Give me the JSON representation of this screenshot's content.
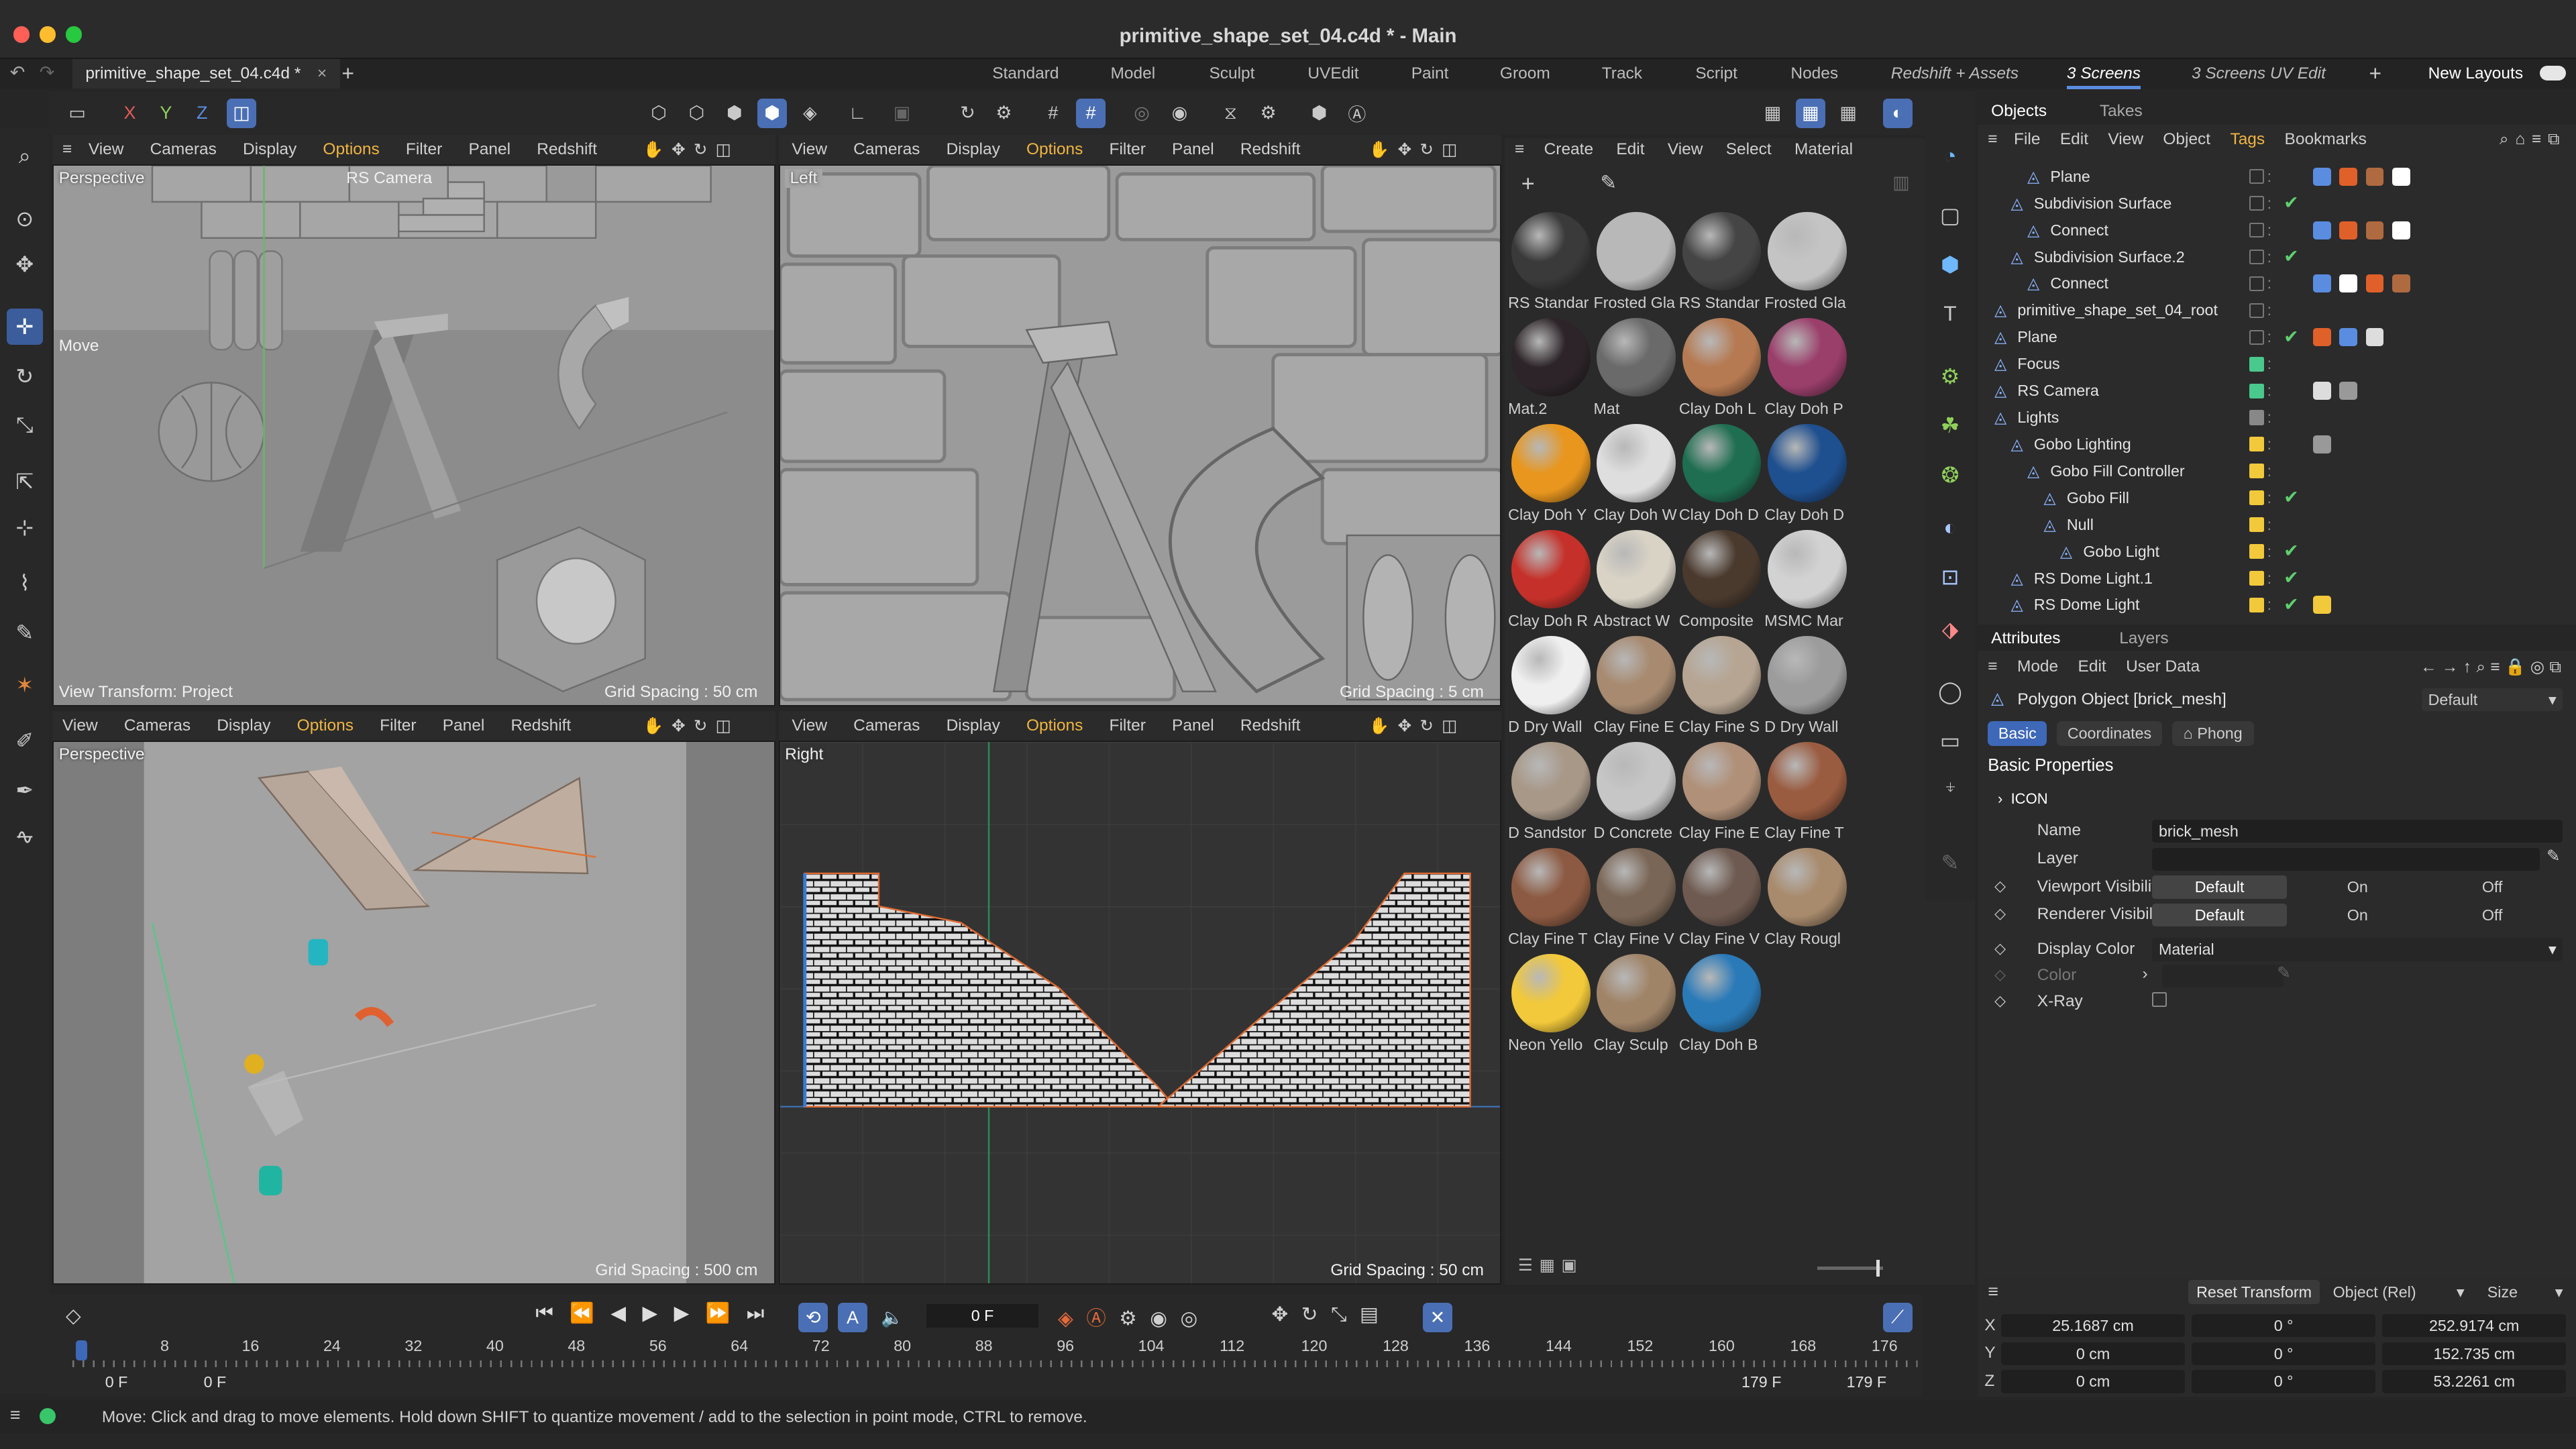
{
  "window": {
    "title": "primitive_shape_set_04.c4d * - Main",
    "file_tab": "primitive_shape_set_04.c4d *"
  },
  "layouts": [
    "Standard",
    "Model",
    "Sculpt",
    "UVEdit",
    "Paint",
    "Groom",
    "Track",
    "Script",
    "Nodes",
    "Redshift + Assets",
    "3 Screens",
    "3 Screens UV Edit"
  ],
  "active_layout": "3 Screens",
  "new_layouts_label": "New Layouts",
  "axis_toggles": [
    "X",
    "Y",
    "Z"
  ],
  "viewport_menu": [
    "View",
    "Cameras",
    "Display",
    "Options",
    "Filter",
    "Panel",
    "Redshift"
  ],
  "viewports": {
    "top_left": {
      "label": "Perspective",
      "camera": "RS Camera",
      "tool": "Move",
      "view_transform": "View Transform: Project",
      "grid": "Grid Spacing : 50 cm"
    },
    "top_right": {
      "label": "Left",
      "grid": "Grid Spacing : 5 cm"
    },
    "bottom_left": {
      "label": "Perspective",
      "grid": "Grid Spacing : 500 cm"
    },
    "bottom_right": {
      "label": "Right",
      "grid": "Grid Spacing : 50 cm"
    }
  },
  "material_manager": {
    "menu": [
      "Create",
      "Edit",
      "View",
      "Select",
      "Material"
    ],
    "materials": [
      {
        "name": "RS Standar",
        "color": "#3a3a3a"
      },
      {
        "name": "Frosted Gla",
        "color": "#b8b8b8"
      },
      {
        "name": "RS Standar",
        "color": "#454545"
      },
      {
        "name": "Frosted Gla",
        "color": "#c4c4c4"
      },
      {
        "name": "Mat.2",
        "color": "#2c2428"
      },
      {
        "name": "Mat",
        "color": "#6a6a6a"
      },
      {
        "name": "Clay Doh L",
        "color": "#b67a52"
      },
      {
        "name": "Clay Doh P",
        "color": "#9a3e6a"
      },
      {
        "name": "Clay Doh Y",
        "color": "#e8961e"
      },
      {
        "name": "Clay Doh W",
        "color": "#dedede"
      },
      {
        "name": "Clay Doh D",
        "color": "#1f6e52"
      },
      {
        "name": "Clay Doh D",
        "color": "#1e4f8e"
      },
      {
        "name": "Clay Doh R",
        "color": "#c5312a"
      },
      {
        "name": "Abstract W",
        "color": "#d9d3c6"
      },
      {
        "name": "Composite",
        "color": "#4a3a2e"
      },
      {
        "name": "MSMC Mar",
        "color": "#d2d2d2"
      },
      {
        "name": "D Dry Wall",
        "color": "#efefef"
      },
      {
        "name": "Clay Fine E",
        "color": "#a78a70"
      },
      {
        "name": "Clay Fine S",
        "color": "#b6a592"
      },
      {
        "name": "D Dry Wall",
        "color": "#9c9c9c"
      },
      {
        "name": "D Sandstor",
        "color": "#a89888"
      },
      {
        "name": "D Concrete",
        "color": "#c6c6c6"
      },
      {
        "name": "Clay Fine E",
        "color": "#b09078"
      },
      {
        "name": "Clay Fine T",
        "color": "#9a5c40"
      },
      {
        "name": "Clay Fine T",
        "color": "#8c5a42"
      },
      {
        "name": "Clay Fine V",
        "color": "#7a6656"
      },
      {
        "name": "Clay Fine V",
        "color": "#6e5a50"
      },
      {
        "name": "Clay Rougl",
        "color": "#a88a6c"
      },
      {
        "name": "Neon Yello",
        "color": "#f2c93a"
      },
      {
        "name": "Clay Sculp",
        "color": "#a08468"
      },
      {
        "name": "Clay Doh B",
        "color": "#2a7ab8"
      }
    ]
  },
  "object_manager": {
    "tabs": [
      "Objects",
      "Takes"
    ],
    "menu": [
      "File",
      "Edit",
      "View",
      "Object",
      "Tags",
      "Bookmarks"
    ],
    "rows": [
      {
        "name": "Plane",
        "indent": 3,
        "vis": "box",
        "check": false
      },
      {
        "name": "Subdivision Surface",
        "indent": 2,
        "vis": "box",
        "check": true
      },
      {
        "name": "Connect",
        "indent": 3,
        "vis": "box",
        "check": false
      },
      {
        "name": "Subdivision Surface.2",
        "indent": 2,
        "vis": "box",
        "check": true
      },
      {
        "name": "Connect",
        "indent": 3,
        "vis": "box",
        "check": false
      },
      {
        "name": "primitive_shape_set_04_root",
        "indent": 1,
        "vis": "box",
        "check": false
      },
      {
        "name": "Plane",
        "indent": 1,
        "vis": "box",
        "check": true
      },
      {
        "name": "Focus",
        "indent": 1,
        "vis": "#49c98c",
        "check": false
      },
      {
        "name": "RS Camera",
        "indent": 1,
        "vis": "#49c98c",
        "check": false
      },
      {
        "name": "Lights",
        "indent": 1,
        "vis": "#888888",
        "check": false
      },
      {
        "name": "Gobo Lighting",
        "indent": 2,
        "vis": "#f2c93a",
        "check": false
      },
      {
        "name": "Gobo Fill Controller",
        "indent": 3,
        "vis": "#f2c93a",
        "check": false
      },
      {
        "name": "Gobo Fill",
        "indent": 4,
        "vis": "#f2c93a",
        "check": true
      },
      {
        "name": "Null",
        "indent": 4,
        "vis": "#f2c93a",
        "check": false
      },
      {
        "name": "Gobo Light",
        "indent": 5,
        "vis": "#f2c93a",
        "check": true
      },
      {
        "name": "RS Dome Light.1",
        "indent": 2,
        "vis": "#f2c93a",
        "check": true
      },
      {
        "name": "RS Dome Light",
        "indent": 2,
        "vis": "#f2c93a",
        "check": true
      }
    ]
  },
  "attributes": {
    "tabs": [
      "Attributes",
      "Layers"
    ],
    "menu": [
      "Mode",
      "Edit",
      "User Data"
    ],
    "object_title": "Polygon Object [brick_mesh]",
    "preset": "Default",
    "subtabs": [
      "Basic",
      "Coordinates",
      "Phong"
    ],
    "section": "Basic Properties",
    "group": "ICON",
    "fields": {
      "name_label": "Name",
      "name_value": "brick_mesh",
      "layer_label": "Layer",
      "viewport_label": "Viewport Visibility",
      "renderer_label": "Renderer Visibility",
      "display_color_label": "Display Color",
      "display_color_value": "Material",
      "color_label": "Color",
      "xray_label": "X-Ray"
    },
    "vis_options": [
      "Default",
      "On",
      "Off"
    ]
  },
  "timeline": {
    "current_frame": "0 F",
    "ticks": [
      "0",
      "8",
      "16",
      "24",
      "32",
      "40",
      "48",
      "56",
      "64",
      "72",
      "80",
      "88",
      "96",
      "104",
      "112",
      "120",
      "128",
      "136",
      "144",
      "152",
      "160",
      "168",
      "176"
    ],
    "start": "0 F",
    "start2": "0 F",
    "end": "179 F",
    "end2": "179 F"
  },
  "coordinates": {
    "reset_label": "Reset Transform",
    "mode": "Object (Rel)",
    "size_label": "Size",
    "rows": [
      {
        "axis": "X",
        "pos": "25.1687 cm",
        "rot": "0 °",
        "size": "252.9174 cm"
      },
      {
        "axis": "Y",
        "pos": "0 cm",
        "rot": "0 °",
        "size": "152.735 cm"
      },
      {
        "axis": "Z",
        "pos": "0 cm",
        "rot": "0 °",
        "size": "53.2261 cm"
      }
    ]
  },
  "status": "Move: Click and drag to move elements. Hold down SHIFT to quantize movement / add to the selection in point mode, CTRL to remove."
}
